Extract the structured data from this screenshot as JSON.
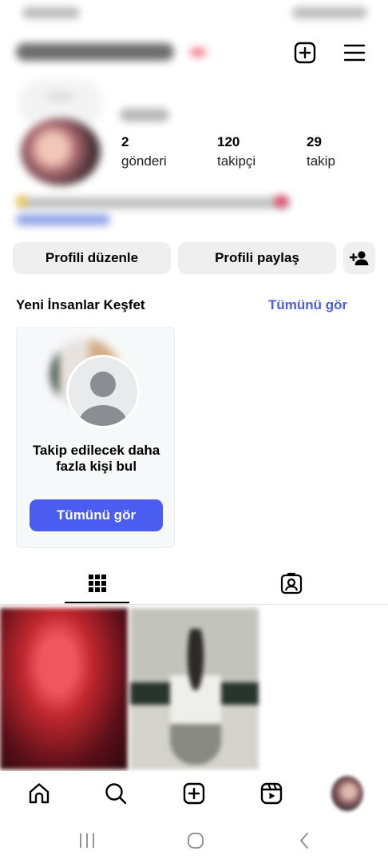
{
  "stats": {
    "posts": {
      "count": "2",
      "label": "gönderi"
    },
    "followers": {
      "count": "120",
      "label": "takipçi"
    },
    "following": {
      "count": "29",
      "label": "takip"
    }
  },
  "actions": {
    "edit_profile": "Profili düzenle",
    "share_profile": "Profili paylaş"
  },
  "discover": {
    "title": "Yeni İnsanlar Keşfet",
    "see_all": "Tümünü gör",
    "card": {
      "text": "Takip edilecek daha fazla kişi bul",
      "button": "Tümünü gör"
    }
  },
  "colors": {
    "accent": "#4a5df0",
    "link": "#4a5de6",
    "button_bg": "#efefef"
  },
  "icons": [
    "create-icon",
    "menu-icon",
    "add-person-icon",
    "grid-icon",
    "tagged-icon",
    "home-icon",
    "search-icon",
    "create-post-icon",
    "reels-icon"
  ]
}
